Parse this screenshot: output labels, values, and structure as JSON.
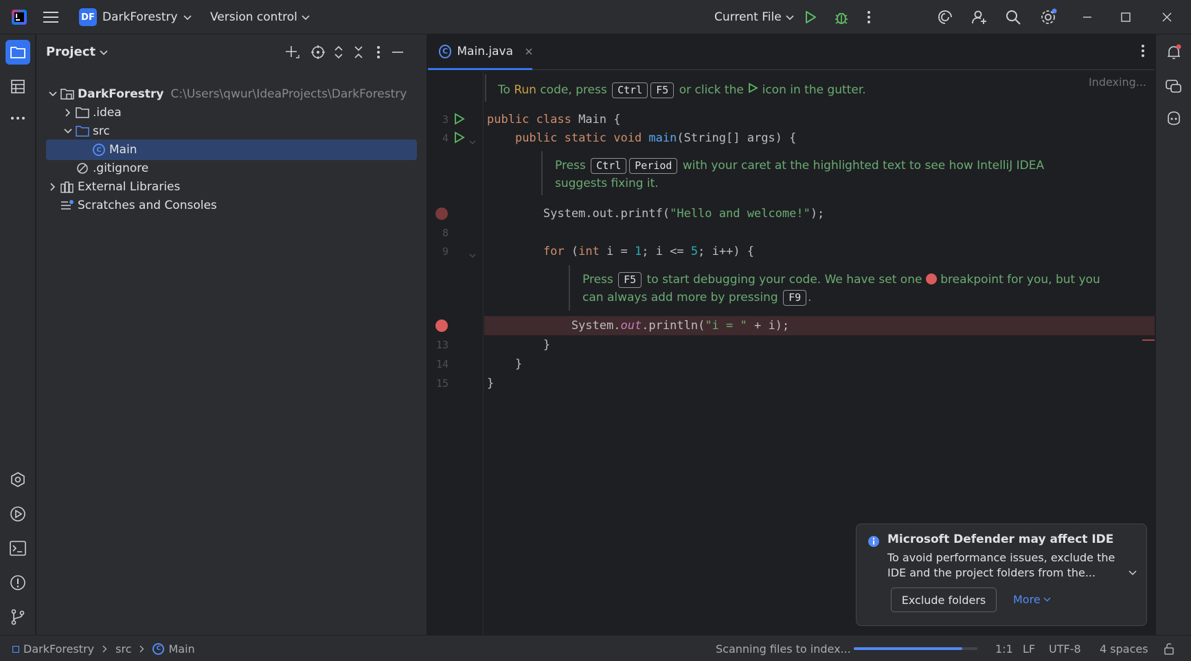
{
  "titlebar": {
    "project_badge": "DF",
    "project_name": "DarkForestry",
    "vcs_label": "Version control",
    "run_config": "Current File"
  },
  "project_panel": {
    "title": "Project",
    "tree": [
      {
        "label": "DarkForestry",
        "hint": "C:\\Users\\qwur\\IdeaProjects\\DarkForestry"
      },
      {
        "label": ".idea"
      },
      {
        "label": "src"
      },
      {
        "label": "Main"
      },
      {
        "label": ".gitignore"
      },
      {
        "label": "External Libraries"
      },
      {
        "label": "Scratches and Consoles"
      }
    ]
  },
  "editor": {
    "tab_label": "Main.java",
    "tab_icon_letter": "C",
    "status": "Indexing...",
    "line_numbers": {
      "l3": "3",
      "l4": "4",
      "l8": "8",
      "l9": "9",
      "l13": "13",
      "l14": "14",
      "l15": "15"
    },
    "hint_run": {
      "pre": "To ",
      "run": "Run",
      "mid": " code, press ",
      "key1": "Ctrl",
      "key2": "F5",
      "post": " or click the ",
      "end": " icon in the gutter."
    },
    "hint_fix": {
      "pre": "Press ",
      "key1": "Ctrl",
      "key2": "Period",
      "post": " with your caret at the highlighted text to see how IntelliJ IDEA",
      "line2": "suggests fixing it."
    },
    "hint_debug": {
      "pre": "Press ",
      "key1": "F5",
      "mid": " to start debugging your code. We have set one ",
      "post": " breakpoint for you, but you",
      "line2a": "can always add more by pressing ",
      "key2": "F9",
      "line2b": "."
    }
  },
  "notification": {
    "title": "Microsoft Defender may affect IDE",
    "body": "To avoid performance issues, exclude the IDE and the project folders from the...",
    "action": "Exclude folders",
    "more": "More"
  },
  "statusbar": {
    "crumb_project": "DarkForestry",
    "crumb_src": "src",
    "crumb_main": "Main",
    "scanning": "Scanning files to index...",
    "progress": 0.88,
    "position": "1:1",
    "line_sep": "LF",
    "encoding": "UTF-8",
    "indent": "4 spaces"
  }
}
